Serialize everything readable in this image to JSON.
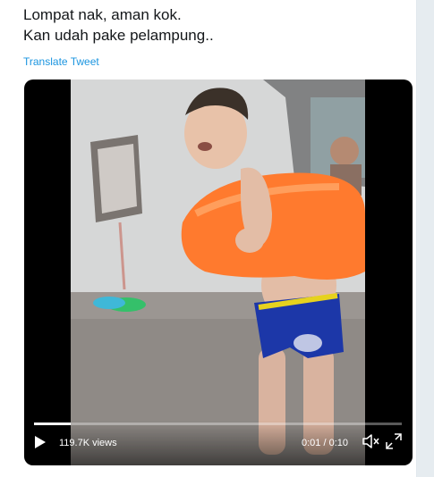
{
  "tweet": {
    "text_line1": "Lompat nak, aman kok.",
    "text_line2": "Kan udah pake pelampung..",
    "translate_label": "Translate Tweet"
  },
  "video": {
    "views": "119.7K views",
    "time": "0:01 / 0:10",
    "progress": 0.1
  },
  "icons": {
    "play": "play-icon",
    "volume": "volume-icon",
    "fullscreen": "fullscreen-icon"
  },
  "colors": {
    "link": "#1b95e0",
    "text": "#14171a",
    "float_ring": "#ff7a2e",
    "swim_trunks": "#1c37a8"
  }
}
